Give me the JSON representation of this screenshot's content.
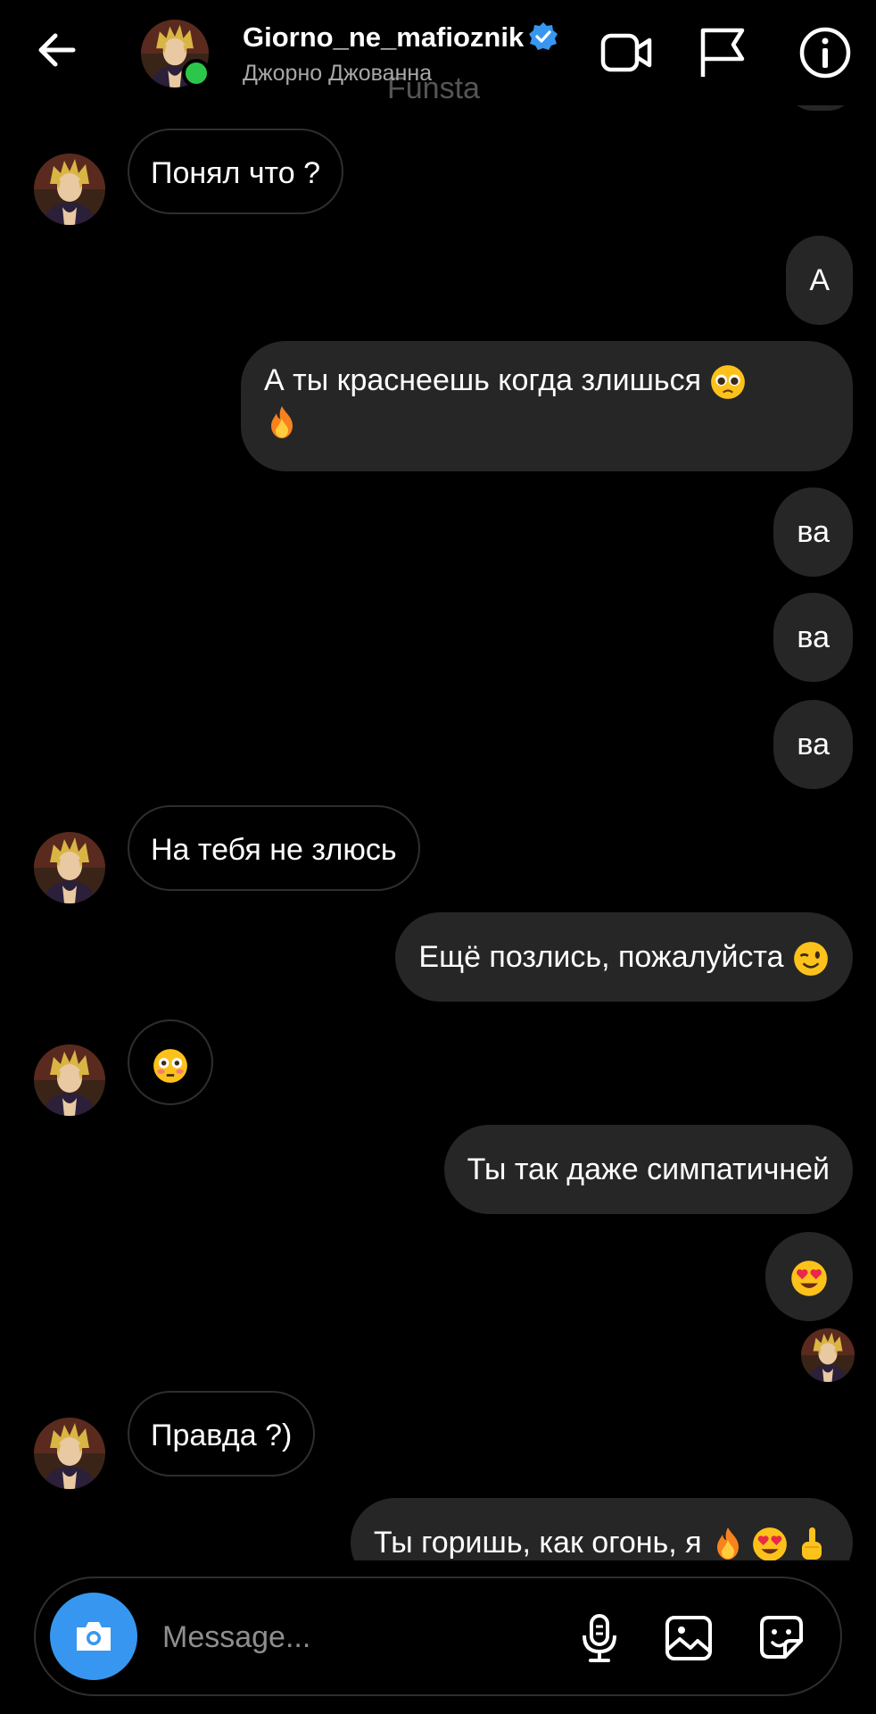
{
  "header": {
    "username": "Giorno_ne_mafioznik",
    "subtitle": "Джорно Джованна",
    "overlay_text": "Funsta",
    "icons": [
      "back-arrow-icon",
      "video-call-icon",
      "flag-icon",
      "info-icon",
      "verified-badge-icon"
    ]
  },
  "messages": [
    {
      "side": "in",
      "text": "Понял что ?"
    },
    {
      "side": "out",
      "text": "А"
    },
    {
      "side": "out",
      "text": "А ты краснеешь когда злишься",
      "emojis": [
        "pleading-face",
        "fire"
      ]
    },
    {
      "side": "out",
      "text": "ва"
    },
    {
      "side": "out",
      "text": "ва"
    },
    {
      "side": "out",
      "text": "ва"
    },
    {
      "side": "in",
      "text": "На тебя не злюсь"
    },
    {
      "side": "out",
      "text": "Ещё позлись, пожалуйста",
      "emojis": [
        "winking-face"
      ]
    },
    {
      "side": "in",
      "emojis": [
        "flushed-face"
      ]
    },
    {
      "side": "out",
      "text": "Ты так даже симпатичней"
    },
    {
      "side": "out",
      "emojis": [
        "heart-eyes-face"
      ]
    },
    {
      "side": "in",
      "text": "Правда ?)"
    },
    {
      "side": "out",
      "text": "Ты горишь, как огонь, я",
      "emojis": [
        "fire",
        "heart-eyes-face",
        "index-pointing-up"
      ]
    }
  ],
  "composer": {
    "placeholder": "Message...",
    "icons": [
      "camera-icon",
      "microphone-icon",
      "gallery-icon",
      "sticker-icon"
    ]
  },
  "colors": {
    "background": "#000000",
    "outgoing_bubble": "#262626",
    "incoming_border": "#2e2e2e",
    "accent_blue": "#3797f0",
    "online_green": "#2cc74a",
    "subtitle_gray": "#a8a8a8"
  }
}
